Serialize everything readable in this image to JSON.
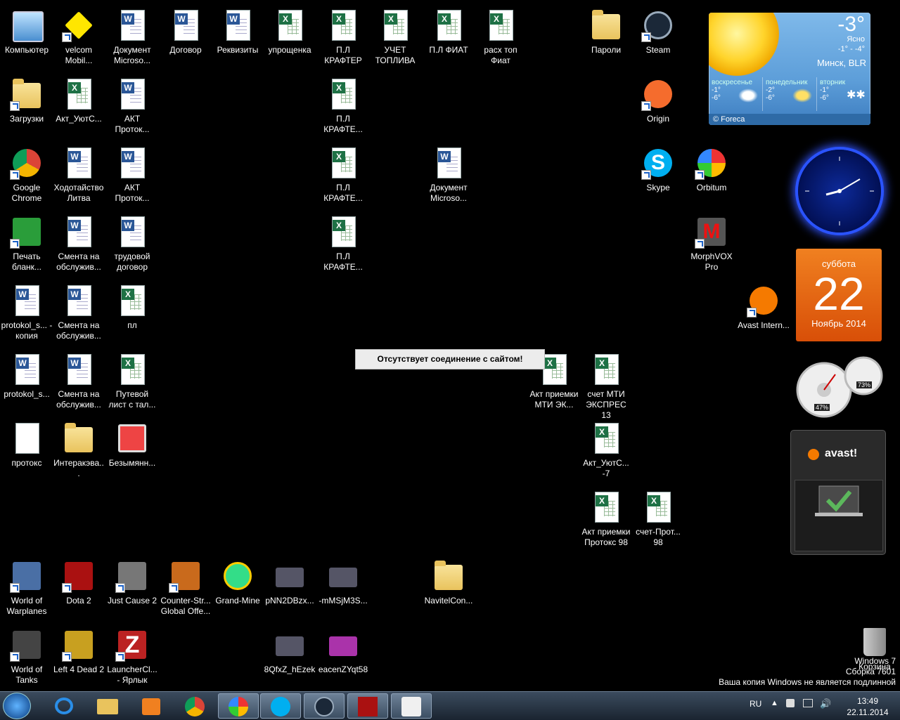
{
  "desktop": {
    "icons": [
      {
        "label": "Компьютер"
      },
      {
        "label": "velcom Mobil..."
      },
      {
        "label": "Документ Microso..."
      },
      {
        "label": "Договор"
      },
      {
        "label": "Реквизиты"
      },
      {
        "label": "упрощенка"
      },
      {
        "label": "П.Л КРАФТЕР"
      },
      {
        "label": "УЧЕТ ТОПЛИВА"
      },
      {
        "label": "П.Л ФИАТ"
      },
      {
        "label": "расх топ Фиат"
      },
      {
        "label": "Пароли"
      },
      {
        "label": "Steam"
      },
      {
        "label": "Загрузки"
      },
      {
        "label": "Акт_УютС..."
      },
      {
        "label": "АКТ Проток..."
      },
      {
        "label": "П.Л КРАФТЕ..."
      },
      {
        "label": "Origin"
      },
      {
        "label": "Google Chrome"
      },
      {
        "label": "Ходотайство Литва"
      },
      {
        "label": "АКТ Проток..."
      },
      {
        "label": "П.Л КРАФТЕ..."
      },
      {
        "label": "Документ Microso..."
      },
      {
        "label": "Skype"
      },
      {
        "label": "Orbitum"
      },
      {
        "label": "Печать бланк..."
      },
      {
        "label": "Смента на обслужив..."
      },
      {
        "label": "трудовой договор"
      },
      {
        "label": "П.Л КРАФТЕ..."
      },
      {
        "label": "MorphVOX Pro"
      },
      {
        "label": "protokol_s... - копия"
      },
      {
        "label": "Смента на обслужив..."
      },
      {
        "label": "пл"
      },
      {
        "label": "Avast Intern..."
      },
      {
        "label": "protokol_s..."
      },
      {
        "label": "Смента на обслужив..."
      },
      {
        "label": "Путевой лист с тал..."
      },
      {
        "label": "Акт приемки МТИ ЭК..."
      },
      {
        "label": "счет МТИ ЭКСПРЕС 13"
      },
      {
        "label": "протокс"
      },
      {
        "label": "Интеракэва..."
      },
      {
        "label": "Безымянн..."
      },
      {
        "label": "Акт_УютС... -7"
      },
      {
        "label": "Акт приемки Протокс 98"
      },
      {
        "label": "счет-Прот... 98"
      },
      {
        "label": "World of Warplanes"
      },
      {
        "label": "Dota 2"
      },
      {
        "label": "Just Cause 2"
      },
      {
        "label": "Counter-Str... Global Offe..."
      },
      {
        "label": "Grand-Mine"
      },
      {
        "label": "pNN2DBzx..."
      },
      {
        "label": "-mMSjM3S..."
      },
      {
        "label": "NavitelCon..."
      },
      {
        "label": "World of Tanks"
      },
      {
        "label": "Left 4 Dead 2"
      },
      {
        "label": "LauncherCl... - Ярлык"
      },
      {
        "label": "8QfxZ_hEzek"
      },
      {
        "label": "eacenZYqt58"
      },
      {
        "label": "Корзина"
      }
    ]
  },
  "dialog": {
    "text": "Отсутствует соединение с сайтом!"
  },
  "weather": {
    "temp": "-3°",
    "condition": "Ясно",
    "range": "-1° - -4°",
    "city": "Минск, BLR",
    "days": [
      {
        "name": "воскресенье",
        "hi": "-1°",
        "lo": "-6°"
      },
      {
        "name": "понедельник",
        "hi": "-2°",
        "lo": "-6°"
      },
      {
        "name": "вторник",
        "hi": "-1°",
        "lo": "-6°"
      }
    ],
    "footer": "© Foreca"
  },
  "calendar": {
    "weekday": "суббота",
    "day": "22",
    "month": "Ноябрь 2014"
  },
  "cpu": {
    "cpu_percent": "47%",
    "mem_percent": "73%"
  },
  "avast": {
    "logo": "avast!"
  },
  "watermark": {
    "line1": "Windows 7",
    "line2": "Сборка 7601",
    "line3": "Ваша копия Windows не является подлинной"
  },
  "taskbar": {
    "lang": "RU",
    "time": "13:49",
    "date": "22.11.2014"
  },
  "colors": {
    "desktop_bg": "#000000"
  }
}
